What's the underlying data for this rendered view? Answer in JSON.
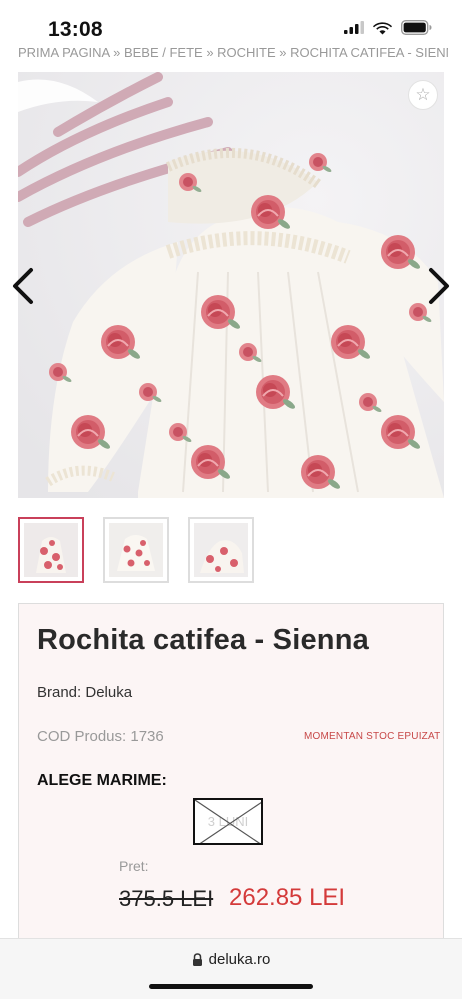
{
  "status_bar": {
    "time": "13:08"
  },
  "breadcrumb": "PRIMA PAGINA » BEBE / FETE » ROCHITE » ROCHITA CATIFEA - SIENNA",
  "product": {
    "title": "Rochita catifea - Sienna",
    "brand": "Brand: Deluka",
    "sku": "COD Produs: 1736",
    "stock_status": "MOMENTAN STOC EPUIZAT",
    "size_heading": "ALEGE MARIME:",
    "size_option": "3 LUNI",
    "price_label": "Pret:",
    "old_price": "375.5 LEI",
    "new_price": "262.85 LEI"
  },
  "gallery": {
    "thumbnails": 3,
    "active_index": 0
  },
  "browser": {
    "url": "deluka.ro"
  },
  "colors": {
    "accent": "#c9405a",
    "sale_price": "#d43a3a",
    "card_bg": "#fcf5f5"
  },
  "icons": [
    "signal-icon",
    "wifi-icon",
    "battery-icon",
    "star-icon",
    "chevron-left-icon",
    "chevron-right-icon",
    "lock-icon"
  ]
}
